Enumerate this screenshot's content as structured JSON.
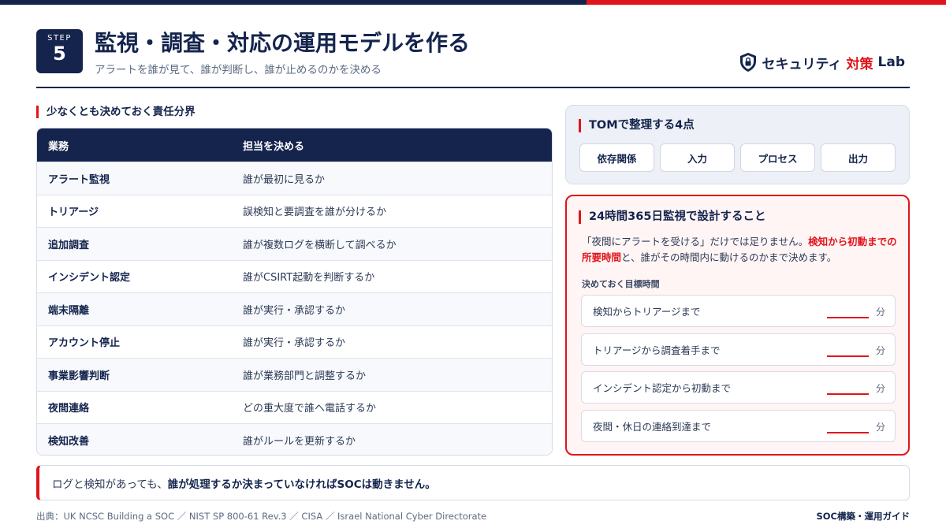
{
  "header": {
    "step_label": "STEP",
    "step_number": "5",
    "title": "監視・調査・対応の運用モデルを作る",
    "subtitle": "アラートを誰が見て、誰が判断し、誰が止めるのかを決める"
  },
  "brand": {
    "part1": "セキュリティ",
    "part2": "対策",
    "part3": "Lab",
    "icon": "shield-lock-icon"
  },
  "responsibility": {
    "section_title": "少なくとも決めておく責任分界",
    "columns": [
      "業務",
      "担当を決める"
    ],
    "rows": [
      {
        "task": "アラート監視",
        "owner": "誰が最初に見るか"
      },
      {
        "task": "トリアージ",
        "owner": "誤検知と要調査を誰が分けるか"
      },
      {
        "task": "追加調査",
        "owner": "誰が複数ログを横断して調べるか"
      },
      {
        "task": "インシデント認定",
        "owner": "誰がCSIRT起動を判断するか"
      },
      {
        "task": "端末隔離",
        "owner": "誰が実行・承認するか"
      },
      {
        "task": "アカウント停止",
        "owner": "誰が実行・承認するか"
      },
      {
        "task": "事業影響判断",
        "owner": "誰が業務部門と調整するか"
      },
      {
        "task": "夜間連絡",
        "owner": "どの重大度で誰へ電話するか"
      },
      {
        "task": "検知改善",
        "owner": "誰がルールを更新するか"
      }
    ]
  },
  "tom": {
    "title": "TOMで整理する4点",
    "items": [
      "依存関係",
      "入力",
      "プロセス",
      "出力"
    ]
  },
  "monitoring": {
    "title": "24時間365日監視で設計すること",
    "desc_pre": "「夜間にアラートを受ける」だけでは足りません。",
    "desc_highlight": "検知から初動までの所要時間",
    "desc_post": "と、誰がその時間内に動けるのかまで決めます。",
    "targets_label": "決めておく目標時間",
    "unit": "分",
    "targets": [
      "検知からトリアージまで",
      "トリアージから調査着手まで",
      "インシデント認定から初動まで",
      "夜間・休日の連絡到達まで"
    ]
  },
  "callout": {
    "pre": "ログと検知があっても、",
    "strong": "誰が処理するか決まっていなければSOCは動きません。"
  },
  "footer": {
    "source": "出典：UK NCSC Building a SOC ／ NIST SP 800-61 Rev.3 ／ CISA ／ Israel National Cyber Directorate",
    "guide": "SOC構築・運用ガイド"
  },
  "colors": {
    "navy": "#14244d",
    "accent_red": "#e0151b"
  }
}
